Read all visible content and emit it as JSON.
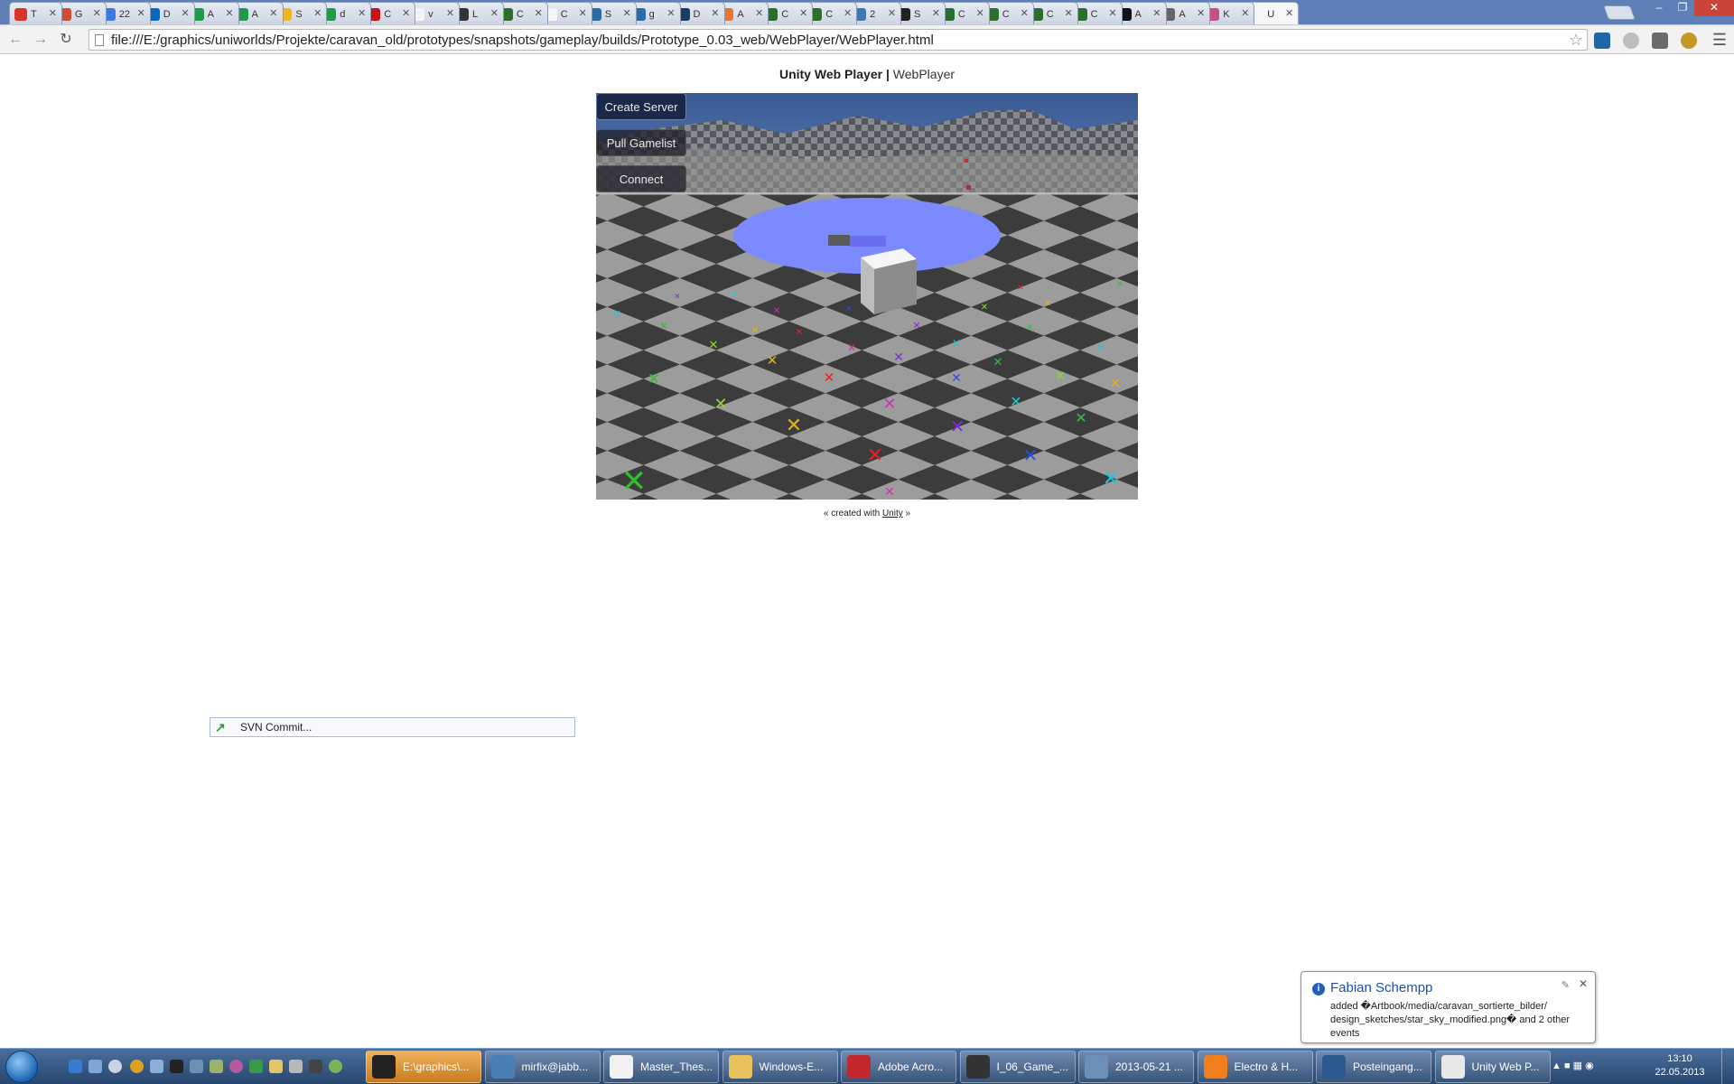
{
  "browser": {
    "tabs": [
      {
        "title": "T",
        "color": "#d9342b"
      },
      {
        "title": "G",
        "color": "#d24b37"
      },
      {
        "title": "22",
        "color": "#3b7be0"
      },
      {
        "title": "D",
        "color": "#0a66c2"
      },
      {
        "title": "A",
        "color": "#1f9a4a"
      },
      {
        "title": "A",
        "color": "#1f9a4a"
      },
      {
        "title": "S",
        "color": "#e8b626"
      },
      {
        "title": "d",
        "color": "#1f9a4a"
      },
      {
        "title": "C",
        "color": "#cc1111"
      },
      {
        "title": "v",
        "color": "#f5f5f5"
      },
      {
        "title": "L",
        "color": "#333333"
      },
      {
        "title": "C",
        "color": "#2c6e2c"
      },
      {
        "title": "C",
        "color": "#f5f5f5"
      },
      {
        "title": "S",
        "color": "#2a6ba8"
      },
      {
        "title": "g",
        "color": "#2a6ba8"
      },
      {
        "title": "D",
        "color": "#1d3b5c"
      },
      {
        "title": "A",
        "color": "#e9772b"
      },
      {
        "title": "C",
        "color": "#2c6e2c"
      },
      {
        "title": "C",
        "color": "#2c6e2c"
      },
      {
        "title": "2",
        "color": "#3c78b5"
      },
      {
        "title": "S",
        "color": "#222222"
      },
      {
        "title": "C",
        "color": "#2c6e2c"
      },
      {
        "title": "C",
        "color": "#2c6e2c"
      },
      {
        "title": "C",
        "color": "#2c6e2c"
      },
      {
        "title": "C",
        "color": "#2c6e2c"
      },
      {
        "title": "A",
        "color": "#111111"
      },
      {
        "title": "A",
        "color": "#666666"
      },
      {
        "title": "K",
        "color": "#c44f8a"
      },
      {
        "title": "U",
        "color": "#f5f5f5"
      }
    ],
    "url": "file:///E:/graphics/uniworlds/Projekte/caravan_old/prototypes/snapshots/gameplay/builds/Prototype_0.03_web/WebPlayer/WebPlayer.html"
  },
  "page": {
    "title_bold": "Unity Web Player",
    "title_sep": " | ",
    "title_sub": "WebPlayer",
    "footer_prefix": "« created with ",
    "footer_link": "Unity",
    "footer_suffix": " »"
  },
  "game": {
    "buttons": [
      "Create Server",
      "Pull Gamelist",
      "Connect"
    ]
  },
  "svn": {
    "label": "SVN Commit..."
  },
  "notification": {
    "author": "Fabian Schempp",
    "message": "added �Artbook/media/caravan_sortierte_bilder/ design_sketches/star_sky_modified.png� and 2 other events"
  },
  "taskbar": {
    "buttons": [
      {
        "label": "E:\\graphics\\...",
        "color": "#222222",
        "active": true
      },
      {
        "label": "mirfix@jabb...",
        "color": "#4a7fb5",
        "active": false
      },
      {
        "label": "Master_Thes...",
        "color": "#f2f2f2",
        "active": false
      },
      {
        "label": "Windows-E...",
        "color": "#e7c25a",
        "active": false
      },
      {
        "label": "Adobe Acro...",
        "color": "#c1272d",
        "active": false
      },
      {
        "label": "I_06_Game_...",
        "color": "#333333",
        "active": false
      },
      {
        "label": "2013-05-21 ...",
        "color": "#6b8fb8",
        "active": false
      },
      {
        "label": "Electro & H...",
        "color": "#f07e1b",
        "active": false
      },
      {
        "label": "Posteingang...",
        "color": "#2d5a8e",
        "active": false
      },
      {
        "label": "Unity Web P...",
        "color": "#e8e8e8",
        "active": false
      }
    ],
    "time": "13:10",
    "date": "22.05.2013"
  }
}
